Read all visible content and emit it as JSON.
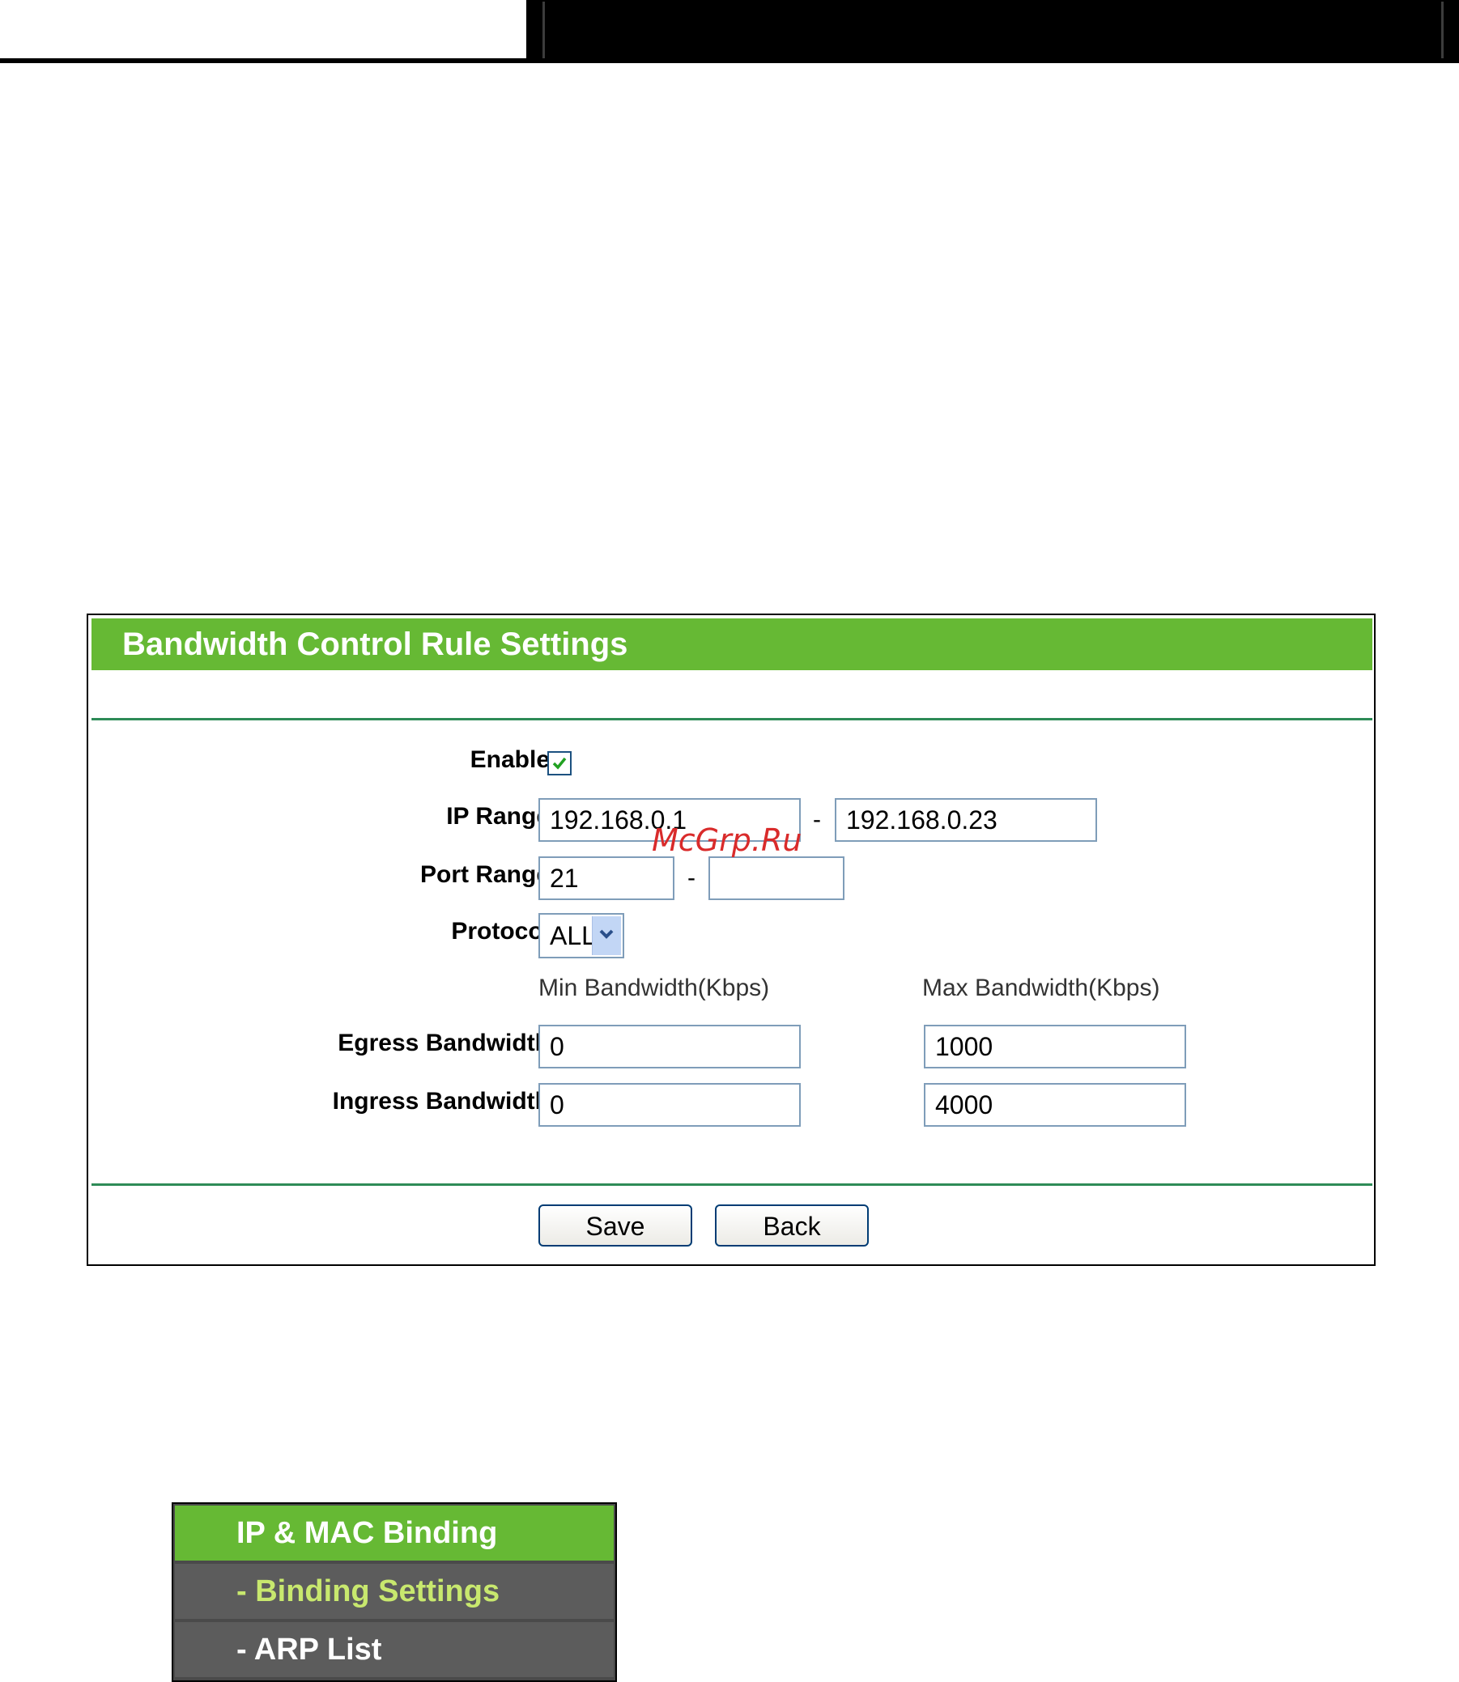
{
  "panel": {
    "title": "Bandwidth Control Rule Settings",
    "enable_label": "Enable:",
    "enable_checked": true,
    "ip_range_label": "IP Range:",
    "ip_start": "192.168.0.1",
    "ip_end": "192.168.0.23",
    "port_range_label": "Port Range:",
    "port_start": "21",
    "port_end": "",
    "range_separator": "-",
    "protocol_label": "Protocol:",
    "protocol_value": "ALL",
    "min_bandwidth_header": "Min Bandwidth(Kbps)",
    "max_bandwidth_header": "Max Bandwidth(Kbps)",
    "egress_label": "Egress Bandwidth:",
    "egress_min": "0",
    "egress_max": "1000",
    "ingress_label": "Ingress Bandwidth:",
    "ingress_min": "0",
    "ingress_max": "4000",
    "save_label": "Save",
    "back_label": "Back"
  },
  "watermark": "McGrp.Ru",
  "menu": {
    "main": "IP & MAC Binding",
    "binding_settings": "- Binding Settings",
    "arp_list": "- ARP List"
  },
  "colors": {
    "header_green": "#66b934",
    "rule_green": "#2e8b57",
    "menu_gray": "#5c5c5c",
    "menu_active_text": "#c8e86e"
  }
}
